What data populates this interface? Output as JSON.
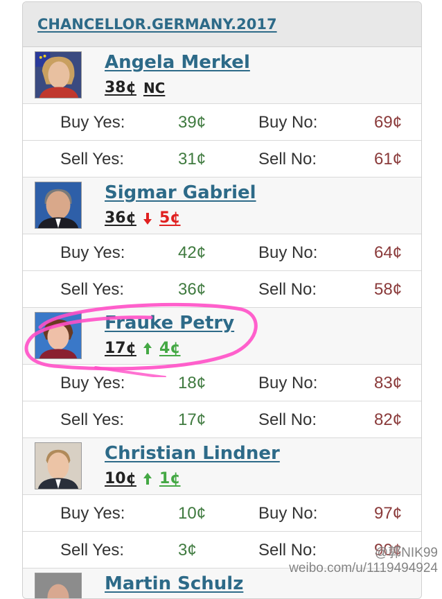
{
  "title": "CHANCELLOR.GERMANY.2017",
  "labels": {
    "buy_yes": "Buy Yes:",
    "buy_no": "Buy No:",
    "sell_yes": "Sell Yes:",
    "sell_no": "Sell No:"
  },
  "candidates": [
    {
      "name": "Angela Merkel",
      "price": "38¢",
      "change": "NC",
      "direction": "none",
      "buy_yes": "39¢",
      "buy_no": "69¢",
      "sell_yes": "31¢",
      "sell_no": "61¢"
    },
    {
      "name": "Sigmar Gabriel",
      "price": "36¢",
      "change": "5¢",
      "direction": "down",
      "buy_yes": "42¢",
      "buy_no": "64¢",
      "sell_yes": "36¢",
      "sell_no": "58¢"
    },
    {
      "name": "Frauke Petry",
      "price": "17¢",
      "change": "4¢",
      "direction": "up",
      "buy_yes": "18¢",
      "buy_no": "83¢",
      "sell_yes": "17¢",
      "sell_no": "82¢"
    },
    {
      "name": "Christian Lindner",
      "price": "10¢",
      "change": "1¢",
      "direction": "up",
      "buy_yes": "10¢",
      "buy_no": "97¢",
      "sell_yes": "3¢",
      "sell_no": "90¢"
    },
    {
      "name": "Martin Schulz",
      "price": "",
      "change": "",
      "direction": "none"
    }
  ],
  "watermark": {
    "handle": "@郭NIK99",
    "url": "weibo.com/u/1119494924"
  },
  "colors": {
    "link": "#2d6a88",
    "yes_value": "#3f7a3f",
    "no_value": "#8a3a3a",
    "down_arrow": "#e02020",
    "up_arrow": "#44a844",
    "highlight": "#ff4fc7"
  }
}
